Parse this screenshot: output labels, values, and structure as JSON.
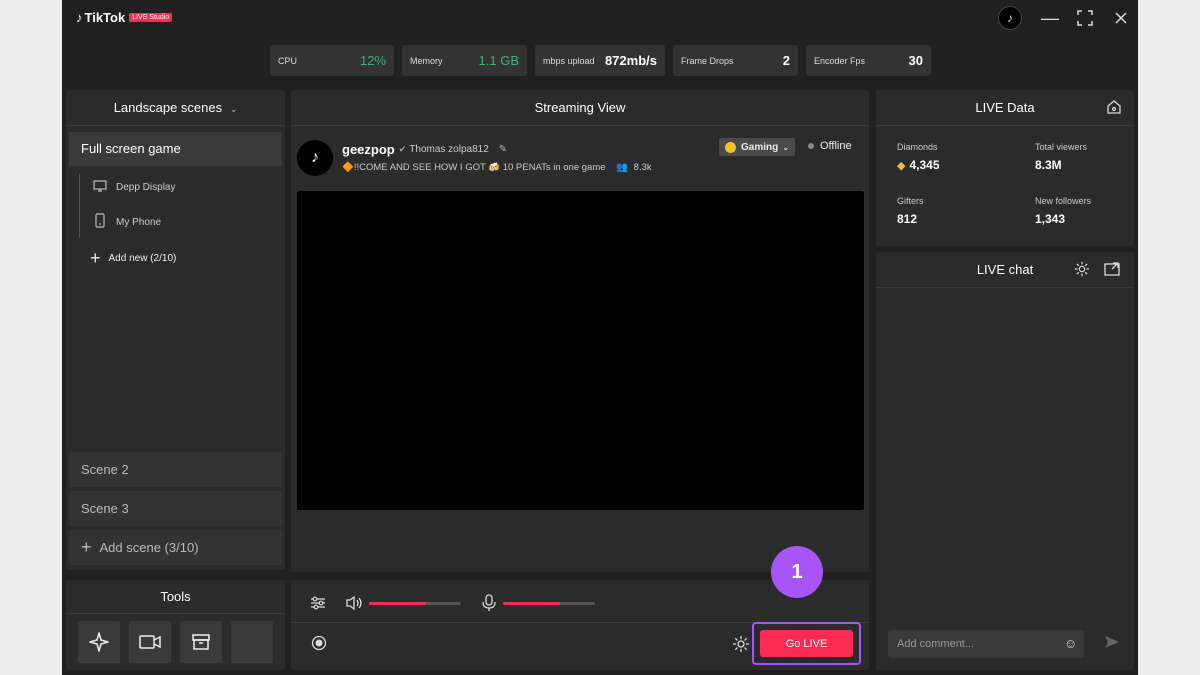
{
  "app": {
    "logo_text": "TikTok",
    "logo_badge": "LIVE Studio"
  },
  "stats": [
    {
      "label": "CPU",
      "value": "12%"
    },
    {
      "label": "Memory",
      "value": "1.1 GB"
    },
    {
      "label": "mbps upload",
      "value": "872mb/s"
    },
    {
      "label": "Frame Drops",
      "value": "2"
    },
    {
      "label": "Encoder Fps",
      "value": "30"
    }
  ],
  "scenes": {
    "title": "Landscape scenes",
    "active": "Full screen game",
    "sources": [
      "Depp Display",
      "My Phone"
    ],
    "add_source": "Add new (2/10)",
    "others": [
      "Scene 2",
      "Scene 3"
    ],
    "add_scene": "Add scene (3/10)"
  },
  "tools": {
    "title": "Tools"
  },
  "stream": {
    "title": "Streaming View",
    "username": "geezpop",
    "realname": "Thomas zolpa812",
    "description": "🔶!!COME AND SEE HOW I GOT 🍻 10 PENATs in one game",
    "viewers": "8.3k",
    "category": "Gaming",
    "status": "Offline"
  },
  "controls": {
    "go_live": "Go LIVE",
    "step_number": "1",
    "volume_level": 0.62,
    "mic_level": 0.62
  },
  "live_data": {
    "title": "LIVE Data",
    "diamonds_label": "Diamonds",
    "diamonds": "4,345",
    "viewers_label": "Total viewers",
    "viewers": "8.3M",
    "gifters_label": "Gifters",
    "gifters": "812",
    "followers_label": "New followers",
    "followers": "1,343"
  },
  "chat": {
    "title": "LIVE chat",
    "placeholder": "Add comment..."
  },
  "colors": {
    "accent": "#fe2c55",
    "highlight": "#a855f7",
    "cpu_green": "#3fb57a"
  }
}
